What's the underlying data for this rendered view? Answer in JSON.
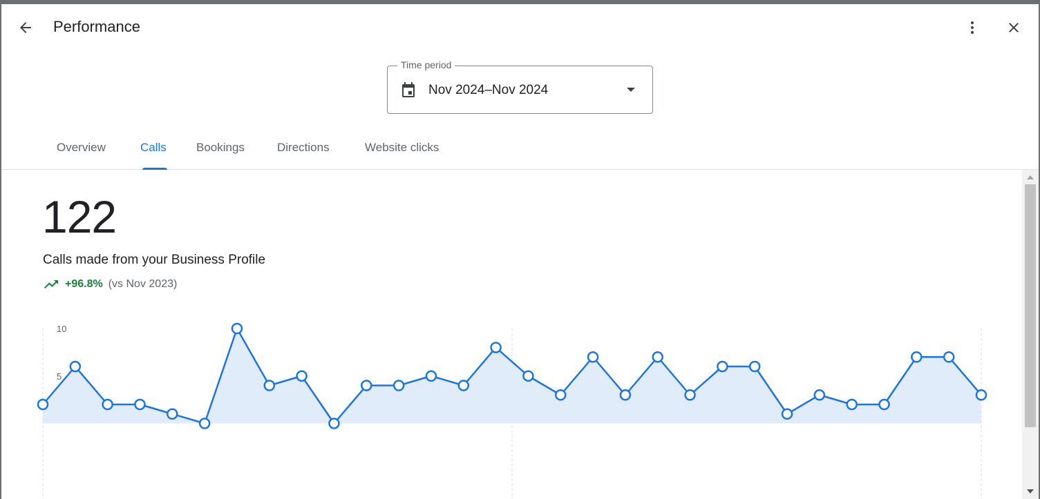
{
  "header": {
    "title": "Performance"
  },
  "period": {
    "label": "Time period",
    "value": "Nov 2024–Nov 2024"
  },
  "tabs": [
    {
      "label": "Overview",
      "active": false
    },
    {
      "label": "Calls",
      "active": true
    },
    {
      "label": "Bookings",
      "active": false
    },
    {
      "label": "Directions",
      "active": false
    },
    {
      "label": "Website clicks",
      "active": false
    }
  ],
  "metric": {
    "value": "122",
    "description": "Calls made from your Business Profile",
    "change": "+96.8%",
    "comparison": "(vs Nov 2023)"
  },
  "colors": {
    "accent": "#1a73e8",
    "positive": "#188038",
    "area_fill": "#e1ecfb"
  },
  "icons": {
    "back": "arrow-back-icon",
    "more": "more-vert-icon",
    "close": "close-icon",
    "calendar": "calendar-icon",
    "caret": "dropdown-caret-icon",
    "trend": "trending-up-icon"
  },
  "chart_data": {
    "type": "area",
    "y_ticks": [
      "10",
      "5"
    ],
    "ylim": [
      0,
      10
    ],
    "values": [
      2,
      6,
      2,
      2,
      1,
      0,
      10,
      4,
      5,
      0,
      4,
      4,
      5,
      4,
      8,
      5,
      3,
      7,
      3,
      7,
      3,
      6,
      6,
      1,
      3,
      2,
      2,
      7,
      7,
      3
    ],
    "grid": "vertical dashed lines"
  }
}
